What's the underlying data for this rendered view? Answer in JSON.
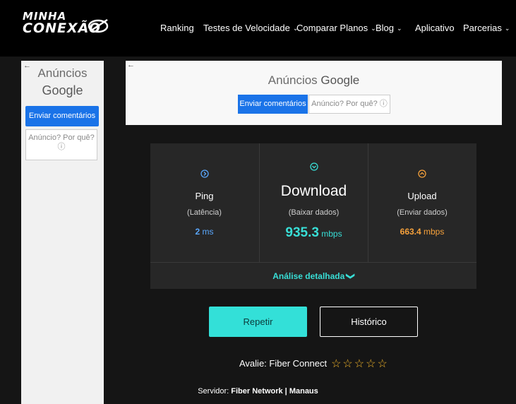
{
  "brand": {
    "line1": "MINHA",
    "line2": "CONEXÃO"
  },
  "nav": {
    "ranking": "Ranking",
    "testes": "Testes de Velocidade",
    "comparar": "Comparar Planos",
    "blog": "Blog",
    "aplicativo": "Aplicativo",
    "parcerias": "Parcerias",
    "chevron": "⌄"
  },
  "side_ad": {
    "back": "←",
    "title1": "Anúncios",
    "title2": "Google",
    "feedback": "Enviar comentários",
    "why_line1": "Anúncio? Por quê?",
    "why_icon": "ⓘ"
  },
  "top_ad": {
    "back": "←",
    "title_a": "Anúncios ",
    "title_b": "Google",
    "feedback": "Enviar comentários",
    "why": "Anúncio? Por quê? ⓘ"
  },
  "result": {
    "ping": {
      "label": "Ping",
      "sub": "(Latência)",
      "value": "2",
      "unit": " ms",
      "color": "#5aa8ff"
    },
    "download": {
      "label": "Download",
      "sub": "(Baixar dados)",
      "value": "935.3",
      "unit": " mbps",
      "color": "#38ded6"
    },
    "upload": {
      "label": "Upload",
      "sub": "(Enviar dados)",
      "value": "663.4",
      "unit": " mbps",
      "color": "#f6a13b"
    },
    "detail": "Análise detalhada",
    "detail_chevron": "❯"
  },
  "actions": {
    "repeat": "Repetir",
    "history": "Histórico"
  },
  "rating": {
    "label": "Avalie: ",
    "provider": "Fiber Connect",
    "stars": "☆☆☆☆☆"
  },
  "server": {
    "label": "Servidor: ",
    "name": "Fiber Network | Manaus"
  }
}
